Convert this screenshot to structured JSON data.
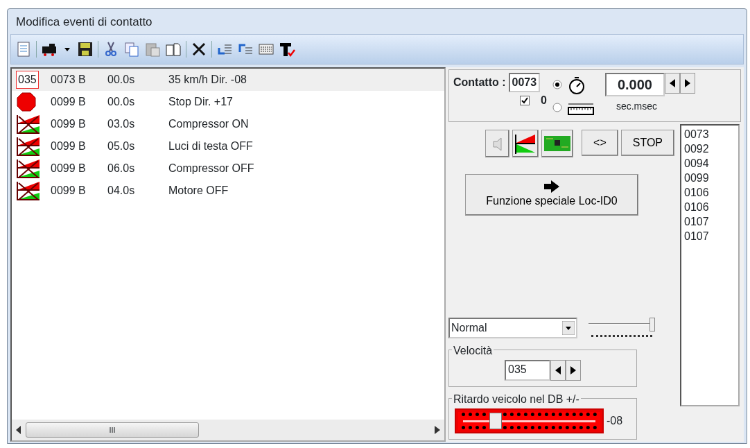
{
  "window": {
    "title": "Modifica eventi di contatto"
  },
  "events": [
    {
      "kind": "speed",
      "badge": "035",
      "contact": "0073 B",
      "time": "00.0s",
      "action": "35 km/h Dir. -08",
      "selected": true
    },
    {
      "kind": "stop",
      "contact": "0099 B",
      "time": "00.0s",
      "action": "Stop Dir. +17",
      "selected": false
    },
    {
      "kind": "function",
      "contact": "0099 B",
      "time": "03.0s",
      "action": "Compressor ON",
      "selected": false
    },
    {
      "kind": "function",
      "contact": "0099 B",
      "time": "05.0s",
      "action": "Luci di testa OFF",
      "selected": false
    },
    {
      "kind": "function",
      "contact": "0099 B",
      "time": "06.0s",
      "action": "Compressor OFF",
      "selected": false
    },
    {
      "kind": "function",
      "contact": "0099 B",
      "time": "04.0s",
      "action": "Motore OFF",
      "selected": false
    }
  ],
  "contact": {
    "label": "Contatto :",
    "value": "0073",
    "checked": true,
    "count": "0",
    "time_mode_selected": true,
    "distance_mode_selected": false,
    "time_value": "0.000",
    "time_unit": "sec.msec"
  },
  "action_buttons": [
    "<>",
    "STOP"
  ],
  "special_button": "Funzione speciale Loc-ID0",
  "contacts_list": [
    "0073",
    "0092",
    "0094",
    "0099",
    "0106",
    "0106",
    "0107",
    "0107"
  ],
  "mode": {
    "value": "Normal",
    "level": 1
  },
  "speed": {
    "label": "Velocità",
    "value": "035"
  },
  "delay": {
    "label": "Ritardo veicolo nel DB +/-",
    "level": 0.27,
    "reading": "-08"
  },
  "scrollbar_grip": "III"
}
